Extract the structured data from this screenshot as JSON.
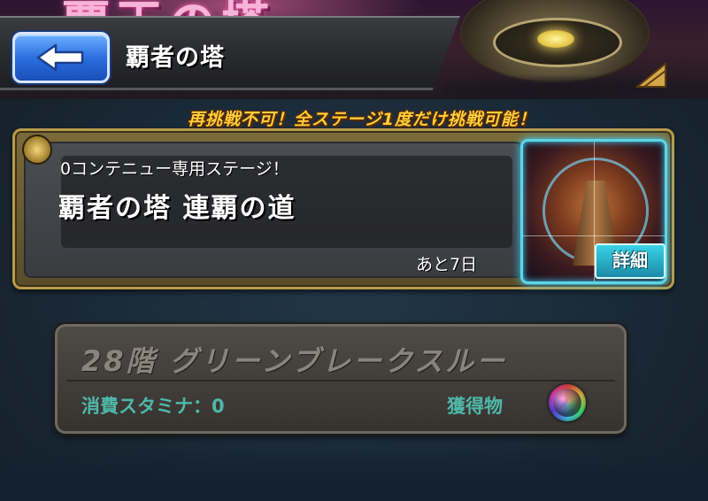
{
  "header": {
    "banner_text": "覇王の塔",
    "title": "覇者の塔",
    "back_icon": "back-arrow-icon"
  },
  "notice": "再挑戦不可！全ステージ1度だけ挑戦可能！",
  "event": {
    "subtitle": "0コンテニュー専用ステージ！",
    "title": "覇者の塔 連覇の道",
    "remaining": "あと7日",
    "detail_label": "詳細"
  },
  "stage": {
    "name": "28階 グリーンブレークスルー",
    "stamina": "消費スタミナ：0",
    "reward_label": "獲得物",
    "reward_icon": "rainbow-orb-icon"
  },
  "colors": {
    "accent_cyan": "#43d3ff",
    "notice_yellow": "#ffcf3a",
    "stat_teal": "#4fb8a8",
    "button_blue": "#2a6fe0"
  }
}
